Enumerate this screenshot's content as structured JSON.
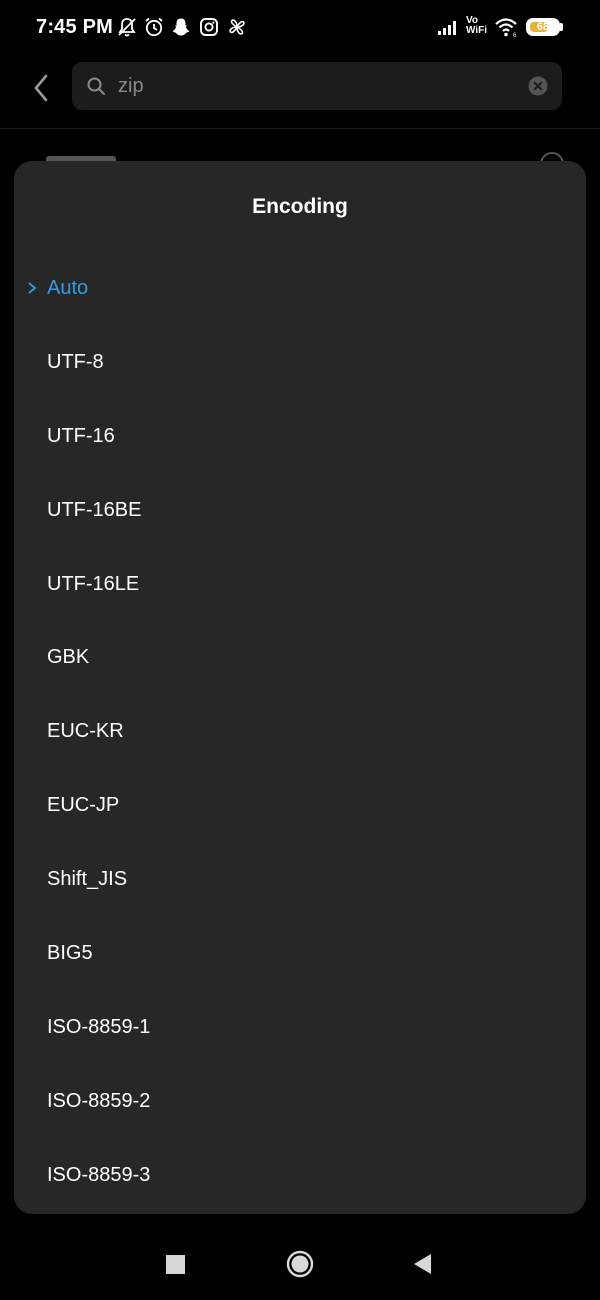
{
  "status_bar": {
    "time": "7:45 PM",
    "icons": [
      "bell-off-icon",
      "alarm-icon",
      "snapchat-icon",
      "instagram-icon",
      "pinwheel-icon",
      "signal-icon",
      "vowifi-icon",
      "wifi-icon",
      "battery-icon"
    ],
    "vowifi_top": "Vo",
    "vowifi_bottom": "WiFi",
    "battery_level": "68",
    "battery_color": "#e9b232"
  },
  "header": {
    "back_icon": "chevron-left-icon",
    "search_icon": "search-icon",
    "search_value": "zip",
    "clear_icon": "clear-circle-icon"
  },
  "dialog": {
    "title": "Encoding",
    "selected_index": 0,
    "accent_color": "#2f9be6",
    "items": [
      {
        "label": "Auto"
      },
      {
        "label": "UTF-8"
      },
      {
        "label": "UTF-16"
      },
      {
        "label": "UTF-16BE"
      },
      {
        "label": "UTF-16LE"
      },
      {
        "label": "GBK"
      },
      {
        "label": "EUC-KR"
      },
      {
        "label": "EUC-JP"
      },
      {
        "label": "Shift_JIS"
      },
      {
        "label": "BIG5"
      },
      {
        "label": "ISO-8859-1"
      },
      {
        "label": "ISO-8859-2"
      },
      {
        "label": "ISO-8859-3"
      }
    ]
  },
  "nav_bar": {
    "recents_icon": "square-recents-icon",
    "home_icon": "circle-home-icon",
    "back_icon": "triangle-back-icon"
  }
}
